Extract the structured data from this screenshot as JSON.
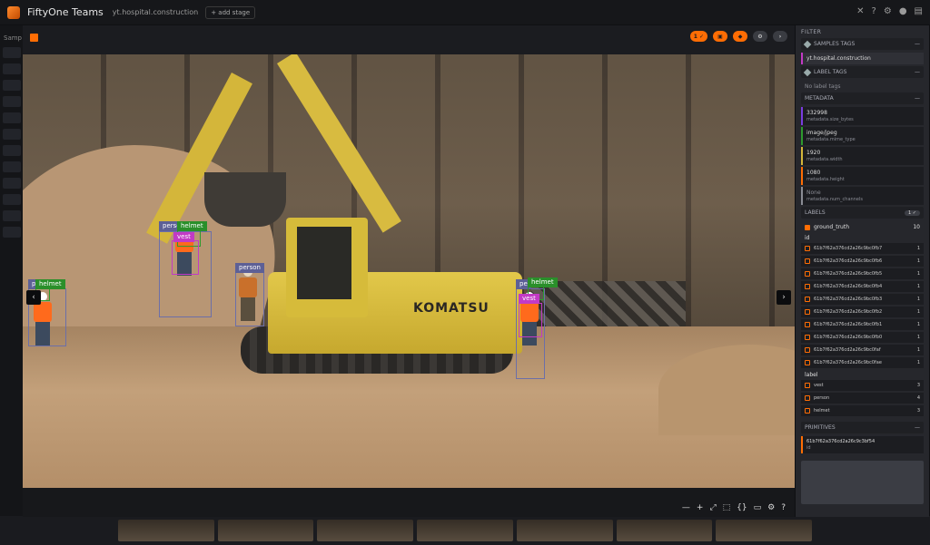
{
  "topbar": {
    "app_title": "FiftyOne Teams",
    "dataset": "yt.hospital.construction",
    "add_stage": "+ add stage",
    "icons": [
      "close-icon",
      "help-icon",
      "settings-icon",
      "github-icon",
      "docs-icon"
    ]
  },
  "background": {
    "left_label": "Samp"
  },
  "header": {
    "actions": [
      {
        "name": "selected-count-button",
        "label": "1 ✓",
        "style": "orange"
      },
      {
        "name": "save-button",
        "label": "▣",
        "style": "orange"
      },
      {
        "name": "tag-button",
        "label": "◆",
        "style": "orange"
      },
      {
        "name": "settings-button",
        "label": "⚙",
        "style": "grey"
      },
      {
        "name": "next-button",
        "label": "›",
        "style": "grey"
      }
    ]
  },
  "viewer": {
    "brand_text": "KOMATSU",
    "detections": [
      {
        "label": "person",
        "cls": "person"
      },
      {
        "label": "helmet",
        "cls": "helmet"
      },
      {
        "label": "vest",
        "cls": "vest"
      },
      {
        "label": "person",
        "cls": "person"
      },
      {
        "label": "pe",
        "cls": "person"
      },
      {
        "label": "helmet",
        "cls": "helmet"
      },
      {
        "label": "pe",
        "cls": "person"
      },
      {
        "label": "helmet",
        "cls": "helmet"
      },
      {
        "label": "vest",
        "cls": "vest"
      }
    ],
    "nav_prev": "‹",
    "nav_next": "›"
  },
  "footer": {
    "tools": [
      "—",
      "+",
      "⤢",
      "⬚",
      "{}",
      "▭",
      "⚙",
      "?"
    ]
  },
  "sidebar": {
    "filter_label": "FILTER",
    "samples_tags": "SAMPLES TAGS",
    "sample_tag_value": "yt.hospital.construction",
    "label_tags": "LABEL TAGS",
    "no_label_tags": "No label tags",
    "metadata_label": "METADATA",
    "metadata": [
      {
        "value": "332998",
        "key": "metadata.size_bytes",
        "color": "#7a3ce0"
      },
      {
        "value": "image/jpeg",
        "key": "metadata.mime_type",
        "color": "#2e9b2e"
      },
      {
        "value": "1920",
        "key": "metadata.width",
        "color": "#d4b63a"
      },
      {
        "value": "1080",
        "key": "metadata.height",
        "color": "#ff6d04"
      },
      {
        "value": "None",
        "key": "metadata.num_channels",
        "color": "#8a8c94"
      }
    ],
    "labels_label": "LABELS",
    "labels_pill": "1 ✓",
    "ground_truth": {
      "name": "ground_truth",
      "count": "10"
    },
    "id_header": "id",
    "ids": [
      {
        "id": "61b7f62a376cd2a26c9bc0fb7",
        "count": "1"
      },
      {
        "id": "61b7f62a376cd2a26c9bc0fb6",
        "count": "1"
      },
      {
        "id": "61b7f62a376cd2a26c9bc0fb5",
        "count": "1"
      },
      {
        "id": "61b7f62a376cd2a26c9bc0fb4",
        "count": "1"
      },
      {
        "id": "61b7f62a376cd2a26c9bc0fb3",
        "count": "1"
      },
      {
        "id": "61b7f62a376cd2a26c9bc0fb2",
        "count": "1"
      },
      {
        "id": "61b7f62a376cd2a26c9bc0fb1",
        "count": "1"
      },
      {
        "id": "61b7f62a376cd2a26c9bc0fb0",
        "count": "1"
      },
      {
        "id": "61b7f62a376cd2a26c9bc0faf",
        "count": "1"
      },
      {
        "id": "61b7f62a376cd2a26c9bc0fae",
        "count": "1"
      }
    ],
    "label_header": "label",
    "label_counts": [
      {
        "label": "vest",
        "count": "3"
      },
      {
        "label": "person",
        "count": "4"
      },
      {
        "label": "helmet",
        "count": "3"
      }
    ],
    "primitives_label": "PRIMITIVES",
    "primitive_id": "61b7f62a376cd2a26c9c3bf54",
    "primitive_key": "id"
  }
}
